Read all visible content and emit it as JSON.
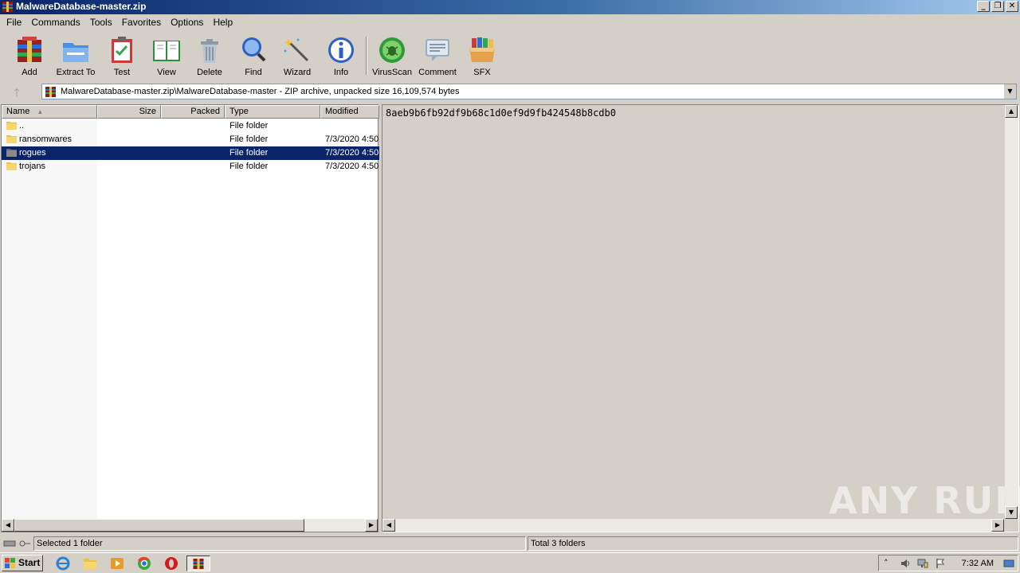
{
  "window": {
    "title": "MalwareDatabase-master.zip",
    "buttons": [
      "_",
      "❐",
      "✕"
    ]
  },
  "menu": [
    "File",
    "Commands",
    "Tools",
    "Favorites",
    "Options",
    "Help"
  ],
  "toolbar": [
    {
      "label": "Add",
      "icon": "add-archive-icon"
    },
    {
      "label": "Extract To",
      "icon": "extract-folder-icon"
    },
    {
      "label": "Test",
      "icon": "test-clipboard-icon"
    },
    {
      "label": "View",
      "icon": "view-book-icon"
    },
    {
      "label": "Delete",
      "icon": "trash-can-icon"
    },
    {
      "label": "Find",
      "icon": "magnifier-icon"
    },
    {
      "label": "Wizard",
      "icon": "magic-wand-icon"
    },
    {
      "label": "Info",
      "icon": "info-icon"
    },
    {
      "label": "VirusScan",
      "icon": "virus-scan-icon"
    },
    {
      "label": "Comment",
      "icon": "comment-icon"
    },
    {
      "label": "SFX",
      "icon": "sfx-box-icon"
    }
  ],
  "address": {
    "path": "MalwareDatabase-master.zip\\MalwareDatabase-master - ZIP archive, unpacked size 16,109,574 bytes"
  },
  "columns": {
    "name": "Name",
    "size": "Size",
    "packed": "Packed",
    "type": "Type",
    "modified": "Modified"
  },
  "files": [
    {
      "name": "..",
      "size": "",
      "packed": "",
      "type": "File folder",
      "modified": "",
      "selected": false
    },
    {
      "name": "ransomwares",
      "size": "",
      "packed": "",
      "type": "File folder",
      "modified": "7/3/2020 4:50",
      "selected": false
    },
    {
      "name": "rogues",
      "size": "",
      "packed": "",
      "type": "File folder",
      "modified": "7/3/2020 4:50",
      "selected": true
    },
    {
      "name": "trojans",
      "size": "",
      "packed": "",
      "type": "File folder",
      "modified": "7/3/2020 4:50",
      "selected": false
    }
  ],
  "comment": "8aeb9b6fb92df9b68c1d0ef9d9fb424548b8cdb0",
  "watermark": "ANY RUN",
  "status": {
    "left": "Selected 1 folder",
    "right": "Total 3 folders"
  },
  "taskbar": {
    "start": "Start",
    "clock": "7:32 AM"
  },
  "colors": {
    "selection": "#0a246a",
    "titlebar_start": "#0a246a",
    "titlebar_end": "#a6caf0",
    "face": "#d4d0c8"
  }
}
